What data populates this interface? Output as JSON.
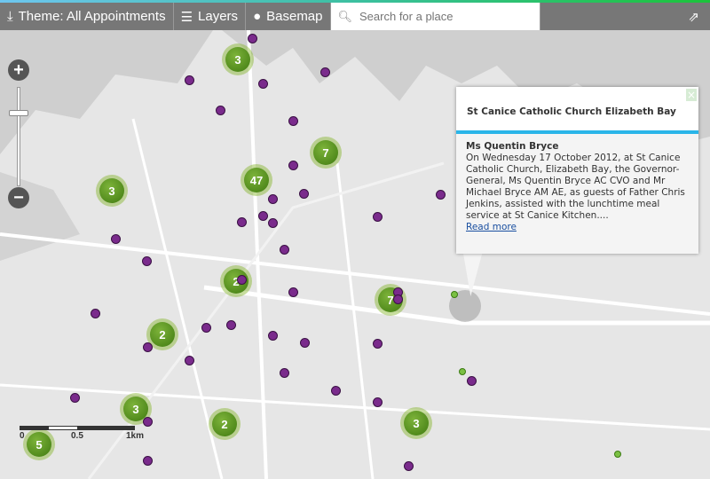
{
  "toolbar": {
    "theme_label": "Theme: All Appointments",
    "layers_label": "Layers",
    "basemap_label": "Basemap",
    "search_placeholder": "Search for a place"
  },
  "map": {
    "clusters": [
      {
        "count": "3"
      },
      {
        "count": "7"
      },
      {
        "count": "3"
      },
      {
        "count": "47"
      },
      {
        "count": "2"
      },
      {
        "count": "7"
      },
      {
        "count": "2"
      },
      {
        "count": "3"
      },
      {
        "count": "2"
      },
      {
        "count": "3"
      },
      {
        "count": "5"
      }
    ],
    "zoom_in": "+",
    "zoom_out": "−"
  },
  "popup": {
    "title": "St Canice Catholic Church Elizabeth Bay",
    "person": "Ms Quentin Bryce",
    "text": "On Wednesday 17 October 2012, at St Canice Catholic Church, Elizabeth Bay, the Governor-General, Ms Quentin Bryce AC CVO and Mr Michael Bryce AM AE, as guests of Father Chris Jenkins, assisted with the lunchtime meal service at St Canice Kitchen....",
    "link": "Read more",
    "close": "×"
  },
  "scale": {
    "labels": [
      "0",
      "0.5",
      "1km"
    ]
  },
  "colors": {
    "cluster": "#5a9a1e",
    "dot": "#7a2b8c",
    "toolbar": "#777777",
    "popup_accent": "#2ab5e8"
  }
}
